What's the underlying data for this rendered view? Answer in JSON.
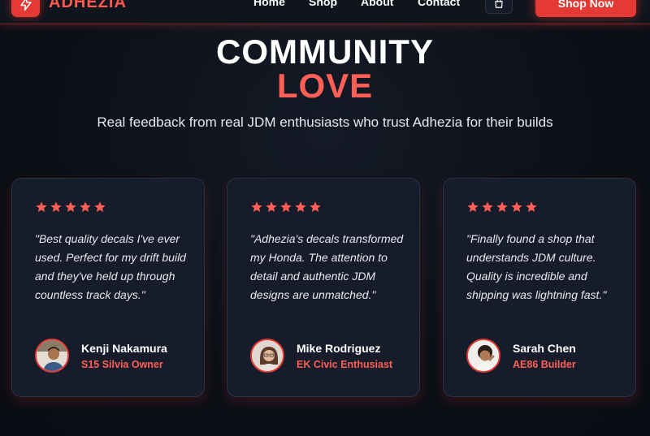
{
  "brand": {
    "name": "ADHEZIA",
    "accent": "#e53935",
    "logo_icon": "lightning-bolt-icon"
  },
  "nav": {
    "links": [
      "Home",
      "Shop",
      "About",
      "Contact"
    ],
    "cart_icon": "shopping-bag-icon",
    "cta_label": "Shop Now"
  },
  "hero": {
    "title_line1": "COMMUNITY",
    "title_line2": "LOVE",
    "subtitle": "Real feedback from real JDM enthusiasts who trust Adhezia for their builds"
  },
  "testimonials": [
    {
      "rating": 5,
      "quote": "\"Best quality decals I've ever used. Perfect for my drift build and they've held up through countless track days.\"",
      "name": "Kenji Nakamura",
      "role": "S15 Silvia Owner"
    },
    {
      "rating": 5,
      "quote": "\"Adhezia's decals transformed my Honda. The attention to detail and authentic JDM designs are unmatched.\"",
      "name": "Mike Rodriguez",
      "role": "EK Civic Enthusiast"
    },
    {
      "rating": 5,
      "quote": "\"Finally found a shop that understands JDM culture. Quality is incredible and shipping was lightning fast.\"",
      "name": "Sarah Chen",
      "role": "AE86 Builder"
    }
  ],
  "colors": {
    "star": "#ff5f57",
    "card_bg": "#161c2a",
    "page_bg": "#0c0f16"
  }
}
